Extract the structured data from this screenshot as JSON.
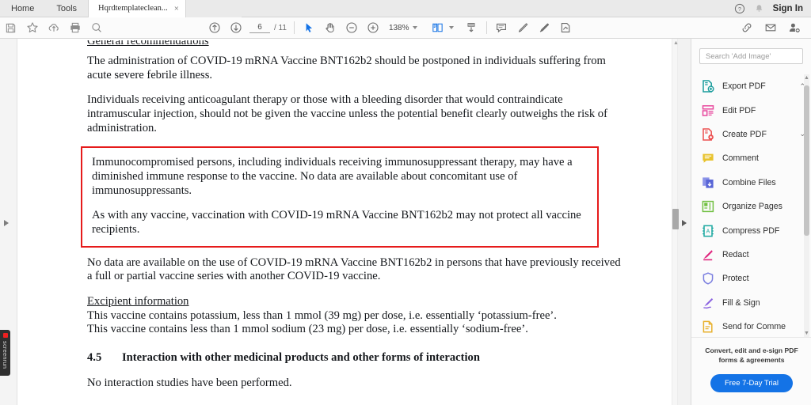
{
  "window": {
    "tabs": [
      {
        "label": "Home",
        "name": "tab-home"
      },
      {
        "label": "Tools",
        "name": "tab-tools"
      }
    ],
    "document_tab": {
      "label": "Hqrdtemplateclean...",
      "close": "×"
    },
    "sign_in": "Sign In"
  },
  "toolbar": {
    "save": "save-icon",
    "star": "star-icon",
    "upload": "upload-cloud-icon",
    "print": "print-icon",
    "find": "search-icon",
    "page_up": "page-up-icon",
    "page_down": "page-down-icon",
    "page_current": "6",
    "page_separator": "/ 11",
    "page_total": "11",
    "select": "cursor-select-icon",
    "hand": "hand-tool-icon",
    "zoom_out": "zoom-out-icon",
    "zoom_in": "zoom-in-icon",
    "zoom_level": "138%",
    "fit_page": "fit-page-icon",
    "scroll_mode": "scroll-mode-icon",
    "comment": "comment-icon",
    "highlight": "highlight-pen-icon",
    "draw": "draw-icon",
    "sign": "sign-icon",
    "help": "help-icon",
    "bell": "bell-icon",
    "share_link": "share-link-icon",
    "email": "email-icon",
    "add_person": "add-person-icon"
  },
  "document": {
    "heading_clipped": "General recommendations",
    "para1": "The administration of COVID-19 mRNA Vaccine BNT162b2 should be postponed in individuals suffering from acute severe febrile illness.",
    "para2": "Individuals receiving anticoagulant therapy or those with a bleeding disorder that would contraindicate intramuscular injection, should not be given the vaccine unless the potential benefit clearly outweighs the risk of administration.",
    "highlight_box": {
      "border_color": "#e61b1b",
      "para1": "Immunocompromised persons, including individuals receiving immunosuppressant therapy, may have a diminished immune response to the vaccine. No data are available about concomitant use of immunosuppressants.",
      "para2": "As with any vaccine, vaccination with COVID-19 mRNA Vaccine BNT162b2 may not protect all vaccine recipients."
    },
    "para3": "No data are available on the use of COVID-19 mRNA Vaccine BNT162b2 in persons that have previously received a full or partial vaccine series with another COVID-19 vaccine.",
    "excipient_heading": "Excipient information",
    "excipient_line1": "This vaccine contains potassium, less than 1 mmol (39 mg) per dose, i.e. essentially ‘potassium-free’.",
    "excipient_line2": "This vaccine contains less than 1 mmol sodium (23 mg) per dose, i.e. essentially ‘sodium-free’.",
    "section_number": "4.5",
    "section_title": "Interaction with other medicinal products and other forms of interaction",
    "para4": "No interaction studies have been performed."
  },
  "recorder": {
    "label": "screenrun"
  },
  "right_panel": {
    "search": {
      "placeholder": "Search 'Add Image'",
      "value": ""
    },
    "items": [
      {
        "label": "Export PDF",
        "icon": "export-pdf-icon",
        "color": "#1a9c9c",
        "chevron": "⌃"
      },
      {
        "label": "Edit PDF",
        "icon": "edit-pdf-icon",
        "color": "#e8499e",
        "chevron": ""
      },
      {
        "label": "Create PDF",
        "icon": "create-pdf-icon",
        "color": "#ec4f4f",
        "chevron": "⌄"
      },
      {
        "label": "Comment",
        "icon": "comment-icon",
        "color": "#e8c32e",
        "chevron": ""
      },
      {
        "label": "Combine Files",
        "icon": "combine-files-icon",
        "color": "#5865d6",
        "chevron": ""
      },
      {
        "label": "Organize Pages",
        "icon": "organize-pages-icon",
        "color": "#72c043",
        "chevron": ""
      },
      {
        "label": "Compress PDF",
        "icon": "compress-pdf-icon",
        "color": "#1aa8a0",
        "chevron": ""
      },
      {
        "label": "Redact",
        "icon": "redact-icon",
        "color": "#e0257e",
        "chevron": ""
      },
      {
        "label": "Protect",
        "icon": "protect-shield-icon",
        "color": "#7b7fe0",
        "chevron": ""
      },
      {
        "label": "Fill & Sign",
        "icon": "fill-and-sign-icon",
        "color": "#8a62e0",
        "chevron": ""
      },
      {
        "label": "Send for Comme",
        "icon": "send-for-comments-icon",
        "color": "#e8b12e",
        "chevron": ""
      }
    ],
    "promo": {
      "text_line1": "Convert, edit and e-sign PDF",
      "text_line2": "forms & agreements",
      "button": "Free 7-Day Trial",
      "button_color": "#1473e6"
    }
  }
}
